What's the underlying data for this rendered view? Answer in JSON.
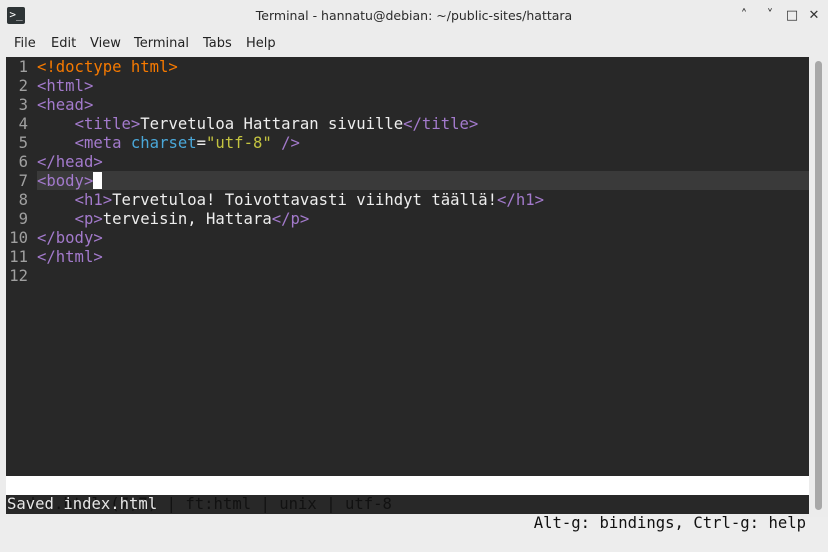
{
  "window": {
    "title": "Terminal - hannatu@debian: ~/public-sites/hattara",
    "icon": "terminal-icon",
    "controls": [
      "˄",
      "˅",
      "□",
      "✕"
    ]
  },
  "menubar": {
    "items": [
      "File",
      "Edit",
      "View",
      "Terminal",
      "Tabs",
      "Help"
    ]
  },
  "editor": {
    "line_numbers": [
      "1",
      "2",
      "3",
      "4",
      "5",
      "6",
      "7",
      "8",
      "9",
      "10",
      "11",
      "12"
    ],
    "lines": [
      {
        "decl": "<!doctype html>"
      },
      {
        "tag": "<html>"
      },
      {
        "tag": "<head>"
      },
      {
        "indent": "    ",
        "open": "<title>",
        "text": "Tervetuloa Hattaran sivuille",
        "close": "</title>"
      },
      {
        "indent": "    ",
        "tag_start": "<meta ",
        "attr": "charset",
        "eq": "=",
        "str": "\"utf-8\"",
        "tag_end": " />"
      },
      {
        "tag": "</head>"
      },
      {
        "tag": "<body>"
      },
      {
        "indent": "    ",
        "open": "<h1>",
        "text": "Tervetuloa! Toivottavasti viihdyt täällä!",
        "close": "</h1>"
      },
      {
        "indent": "    ",
        "open": "<p>",
        "text": "terveisin, Hattara",
        "close": "</p>"
      },
      {
        "tag": "</body>"
      },
      {
        "tag": "</html>"
      },
      {
        "tag": ""
      }
    ],
    "cursor_position": "(7,7)"
  },
  "statusbar": {
    "left": "index.html (7,7) | ft:html | unix | utf-8",
    "right": "Alt-g: bindings, Ctrl-g: help"
  },
  "message": "Saved index.html",
  "colors": {
    "background": "#282828",
    "doctype": "#f57900",
    "tag": "#a37acc",
    "attribute": "#4aa7d8",
    "string": "#c4c440"
  }
}
